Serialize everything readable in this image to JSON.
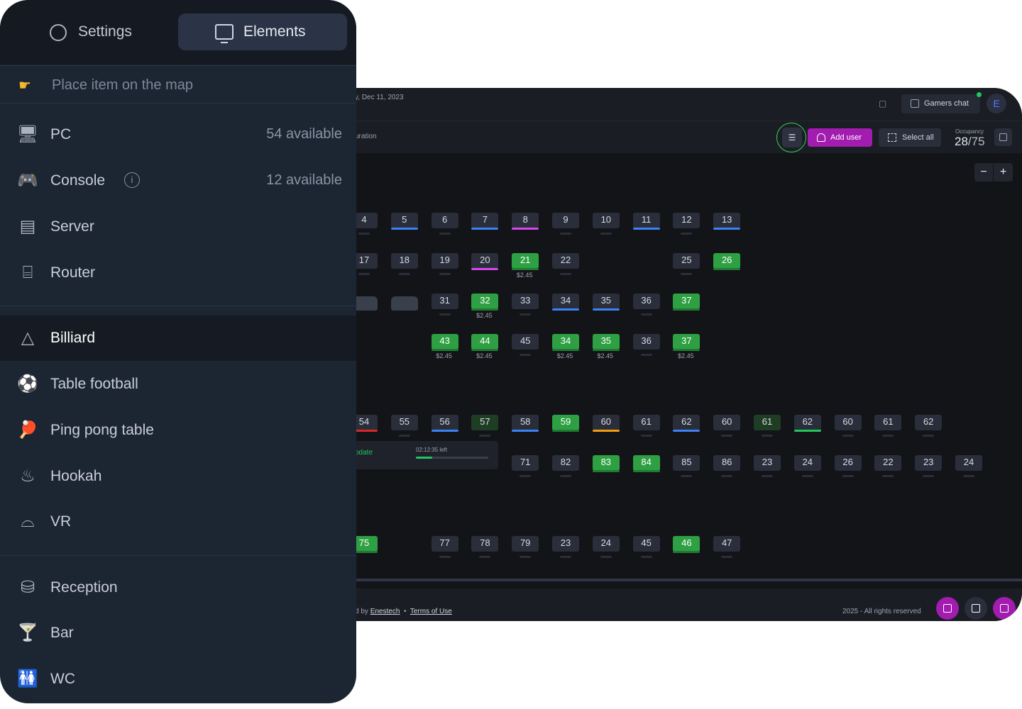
{
  "sidebar": {
    "tabs": {
      "settings": "Settings",
      "elements": "Elements"
    },
    "hint": "Place item on the map",
    "devices": [
      {
        "label": "PC",
        "available": "54 available",
        "icon": "monitor-icon"
      },
      {
        "label": "Console",
        "available": "12 available",
        "icon": "gamepad-icon",
        "info": "i"
      },
      {
        "label": "Server",
        "icon": "server-icon"
      },
      {
        "label": "Router",
        "icon": "router-icon"
      }
    ],
    "amenities": [
      {
        "label": "Billiard",
        "icon": "billiard-icon",
        "active": true
      },
      {
        "label": "Table football",
        "icon": "football-icon"
      },
      {
        "label": "Ping pong table",
        "icon": "ping-pong-icon"
      },
      {
        "label": "Hookah",
        "icon": "hookah-icon"
      },
      {
        "label": "VR",
        "icon": "vr-headset-icon"
      }
    ],
    "facilities": [
      {
        "label": "Reception",
        "icon": "reception-icon"
      },
      {
        "label": "Bar",
        "icon": "cocktail-icon"
      },
      {
        "label": "WC",
        "icon": "restroom-icon"
      }
    ]
  },
  "map": {
    "date": "y, Dec 11, 2023",
    "gamers_chat": "Gamers chat",
    "avatar_letter": "E",
    "duration_label": "uration",
    "add_user": "Add user",
    "select_all": "Select all",
    "occupancy_label": "Occupancy",
    "occupancy_current": "28",
    "occupancy_total": "75",
    "zoom_minus": "−",
    "zoom_plus": "+",
    "popup_update": "pdate",
    "popup_time_left": "02:12:35 left",
    "popup_progress": 0.23,
    "footer_left_prefix": "d by",
    "footer_company": "Enestech",
    "footer_sep": "•",
    "footer_terms": "Terms of Use",
    "footer_right": "2025 - All rights reserved",
    "colors": {
      "free": "#2a2e3a",
      "occupied": "#2ea043",
      "blue": "#3b82f6",
      "magenta": "#d946ef",
      "red": "#dc2626",
      "orange": "#f59e0b",
      "green": "#22c55e",
      "accent": "#a21caf"
    },
    "row1": [
      {
        "n": "4"
      },
      {
        "n": "5",
        "bar": "blue"
      },
      {
        "n": "6"
      },
      {
        "n": "7",
        "bar": "blue"
      },
      {
        "n": "8",
        "bar": "magenta"
      },
      {
        "n": "9"
      },
      {
        "n": "10"
      },
      {
        "n": "11",
        "bar": "blue"
      },
      {
        "n": "12"
      },
      {
        "n": "13",
        "bar": "blue"
      }
    ],
    "row2": [
      {
        "n": "17"
      },
      {
        "n": "18"
      },
      {
        "n": "19"
      },
      {
        "n": "20",
        "bar": "magenta"
      },
      {
        "n": "21",
        "state": "g",
        "price": "$2.45"
      },
      {
        "n": "22"
      },
      {
        "n": "25"
      },
      {
        "n": "26",
        "state": "g"
      }
    ],
    "row3": [
      {
        "n": "31"
      },
      {
        "n": "32",
        "state": "g",
        "price": "$2.45"
      },
      {
        "n": "33"
      },
      {
        "n": "34",
        "bar": "blue"
      },
      {
        "n": "35",
        "bar": "blue"
      },
      {
        "n": "36"
      },
      {
        "n": "37",
        "state": "g"
      }
    ],
    "row4": [
      {
        "n": "43",
        "state": "g",
        "price": "$2.45"
      },
      {
        "n": "44",
        "state": "g",
        "price": "$2.45"
      },
      {
        "n": "45"
      },
      {
        "n": "34",
        "state": "g",
        "price": "$2.45"
      },
      {
        "n": "35",
        "state": "g",
        "price": "$2.45"
      },
      {
        "n": "36"
      },
      {
        "n": "37",
        "state": "g",
        "price": "$2.45"
      }
    ],
    "row5": [
      {
        "n": "54",
        "bar": "red"
      },
      {
        "n": "55"
      },
      {
        "n": "56",
        "bar": "blue"
      },
      {
        "n": "57",
        "state": "dg"
      },
      {
        "n": "58",
        "bar": "blue"
      },
      {
        "n": "59",
        "state": "g"
      },
      {
        "n": "60",
        "bar": "orange"
      },
      {
        "n": "61"
      },
      {
        "n": "62",
        "bar": "blue"
      },
      {
        "n": "60"
      },
      {
        "n": "61",
        "state": "dg"
      },
      {
        "n": "62",
        "bar": "green"
      },
      {
        "n": "60"
      },
      {
        "n": "61"
      },
      {
        "n": "62"
      }
    ],
    "row6": [
      {
        "n": "71"
      },
      {
        "n": "82"
      },
      {
        "n": "83",
        "state": "g"
      },
      {
        "n": "84",
        "state": "g"
      },
      {
        "n": "85"
      },
      {
        "n": "86"
      },
      {
        "n": "23"
      },
      {
        "n": "24"
      },
      {
        "n": "26"
      },
      {
        "n": "22"
      },
      {
        "n": "23"
      },
      {
        "n": "24"
      }
    ],
    "row7": [
      {
        "n": "75",
        "state": "g"
      },
      {
        "n": "77"
      },
      {
        "n": "78"
      },
      {
        "n": "79"
      },
      {
        "n": "23"
      },
      {
        "n": "24"
      },
      {
        "n": "45"
      },
      {
        "n": "46",
        "state": "g"
      },
      {
        "n": "47"
      }
    ]
  }
}
